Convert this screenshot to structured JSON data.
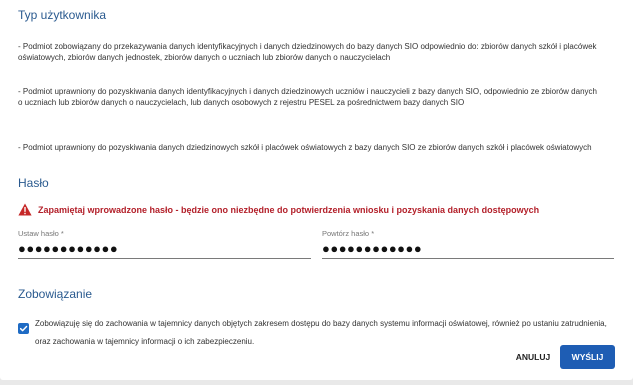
{
  "user_type": {
    "title": "Typ użytkownika",
    "options": [
      "- Podmiot zobowiązany do przekazywania danych identyfikacyjnych i danych dziedzinowych do bazy danych SIO odpowiednio do: zbiorów danych szkół i placówek oświatowych, zbiorów danych jednostek, zbiorów danych o uczniach lub zbiorów danych o nauczycielach",
      "- Podmiot uprawniony do pozyskiwania danych identyfikacyjnych i danych dziedzinowych uczniów i nauczycieli z bazy danych SIO, odpowiednio ze zbiorów danych o uczniach lub zbiorów danych o nauczycielach, lub danych osobowych z rejestru PESEL za pośrednictwem bazy danych SIO",
      "- Podmiot uprawniony do pozyskiwania danych dziedzinowych szkół i placówek oświatowych z bazy danych SIO ze zbiorów danych szkół i placówek oświatowych"
    ]
  },
  "password": {
    "title": "Hasło",
    "warning": "Zapamiętaj wprowadzone hasło - będzie ono niezbędne do potwierdzenia wniosku i pozyskania danych dostępowych",
    "set_label": "Ustaw hasło *",
    "set_value": "●●●●●●●●●●●●",
    "repeat_label": "Powtórz hasło *",
    "repeat_value": "●●●●●●●●●●●●"
  },
  "commitment": {
    "title": "Zobowiązanie",
    "text": "Zobowiązuję się do zachowania w tajemnicy danych objętych zakresem dostępu do bazy danych systemu informacji oświatowej, również po ustaniu zatrudnienia, oraz zachowania w tajemnicy informacji o ich zabezpieczeniu.",
    "checked": true
  },
  "actions": {
    "cancel": "ANULUJ",
    "send": "WYŚLIJ"
  },
  "colors": {
    "section_title": "#2a5a8f",
    "warning": "#b3202a",
    "primary": "#1e5db4"
  }
}
